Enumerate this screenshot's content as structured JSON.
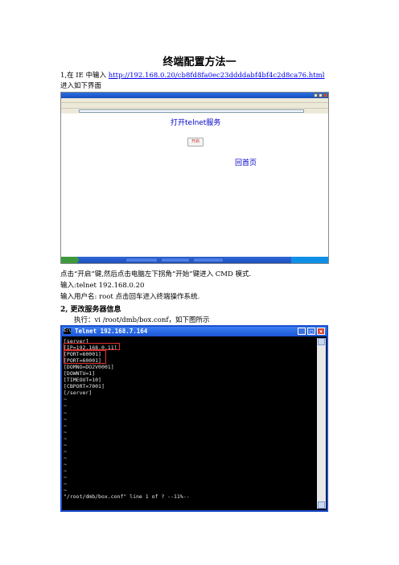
{
  "doc": {
    "title": "终端配置方法一",
    "step1_prefix": "1,在 IE 中输入",
    "step1_url": "http://192.168.0.20/cb8fd8fa0ec23ddddabf4bf4c2d8ca76.html",
    "enter_page": "进入如下界面",
    "after_click": "点击“开启”键,然后点击电脑左下拐角“开始”键进入 CMD 模式.",
    "input_telnet": "输入:telnet 192.168.0.20",
    "input_user": "输入用户名: root      点击回车进入终端操作系统.",
    "step2_heading": "2,   更改服务器信息",
    "exec_line": "执行：vi /root/dmb/box.conf，如下图所示"
  },
  "ie_screenshot": {
    "open_telnet": "打开telnet服务",
    "open_button": "开启",
    "back_home": "回首页"
  },
  "telnet": {
    "window_title": "Telnet 192.168.7.164",
    "lines": [
      "[server]",
      "[IP=192.168.0.11]",
      "[PORT=60001]",
      "[PORT=60001]",
      "[DOMNO=DO2V0001]",
      "[DOWNTU=1]",
      "[TIMEOUT=10]",
      "[CBPORT=7001]",
      "[/server]",
      "~",
      "~",
      "~",
      "~",
      "~",
      "~",
      "~",
      "~",
      "~",
      "~",
      "~",
      "~",
      "~",
      "~",
      "~",
      "\"/root/dmb/box.conf\" line 1 of ? --11%--"
    ]
  }
}
